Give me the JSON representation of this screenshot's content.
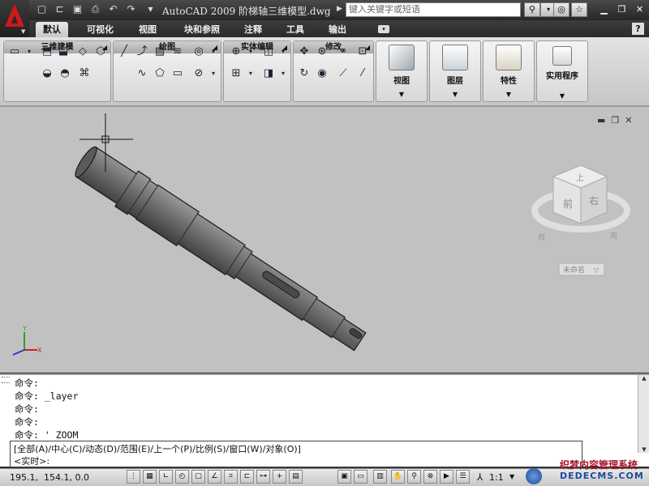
{
  "app": {
    "title": "AutoCAD 2009 阶梯轴三维模型.dwg",
    "search_placeholder": "键入关键字或短语",
    "help_label": "?"
  },
  "tabs": [
    "默认",
    "可视化",
    "视图",
    "块和参照",
    "注释",
    "工具",
    "输出"
  ],
  "active_tab": "默认",
  "ribbon": {
    "panels": [
      {
        "label": "三维建模"
      },
      {
        "label": "绘图"
      },
      {
        "label": "实体编辑"
      },
      {
        "label": "修改"
      }
    ],
    "big_buttons": [
      {
        "label": "视图"
      },
      {
        "label": "图层"
      },
      {
        "label": "特性"
      },
      {
        "label": "实用程序"
      }
    ]
  },
  "viewport": {
    "viewcube_faces": {
      "top": "上",
      "front": "前",
      "right": "右"
    },
    "compass": {
      "west": "西",
      "south": "南"
    },
    "ucs_name": "未命名"
  },
  "command": {
    "history": [
      "命令:",
      "命令: _layer",
      "命令:",
      "命令:",
      "命令: ' ZOOM"
    ],
    "options": "[全部(A)/中心(C)/动态(D)/范围(E)/上一个(P)/比例(S)/窗口(W)/对象(O)]",
    "prompt": "<实时>:"
  },
  "status": {
    "coordinates": "195.1,  154.1, 0.0",
    "annotation_scale": "1:1"
  },
  "watermark": {
    "line1": "织梦内容管理系统",
    "line2": "DEDECMS.COM"
  },
  "colors": {
    "accent": "#d01818",
    "viewport_bg": "#c1c1c1"
  }
}
